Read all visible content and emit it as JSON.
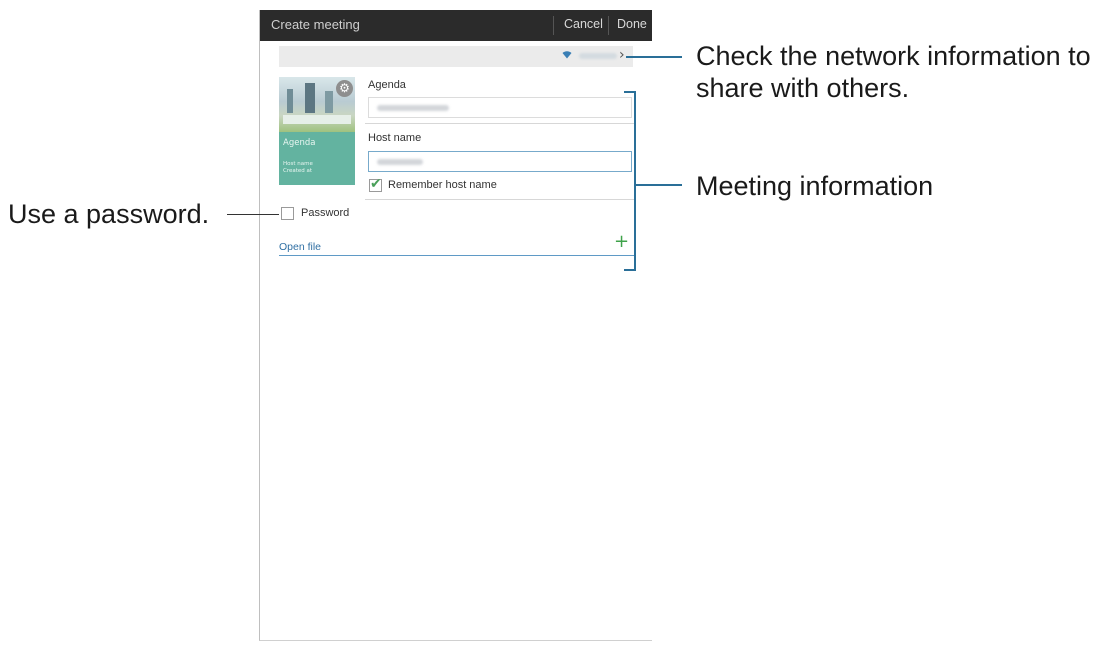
{
  "actionbar": {
    "title": "Create meeting",
    "cancel_label": "Cancel",
    "done_label": "Done"
  },
  "network": {
    "chevron": "›"
  },
  "thumbnail": {
    "agenda": "Agenda",
    "host_name": "Host name",
    "created_at": "Created at"
  },
  "form": {
    "agenda_label": "Agenda",
    "host_name_label": "Host name",
    "remember_host_label": "Remember host name",
    "remember_host_checked": true,
    "password_label": "Password",
    "password_checked": false,
    "open_file_label": "Open file",
    "add_symbol": "+"
  },
  "annotations": {
    "network": "Check the network information to share with others.",
    "meeting": "Meeting information",
    "password": "Use a password."
  },
  "colors": {
    "actionbar_bg": "#2b2b2b",
    "thumbnail_bg": "#63b3a0",
    "accent_link": "#2f6fa3",
    "check_green": "#4aa05a",
    "annotation_line": "#2a6f98"
  }
}
